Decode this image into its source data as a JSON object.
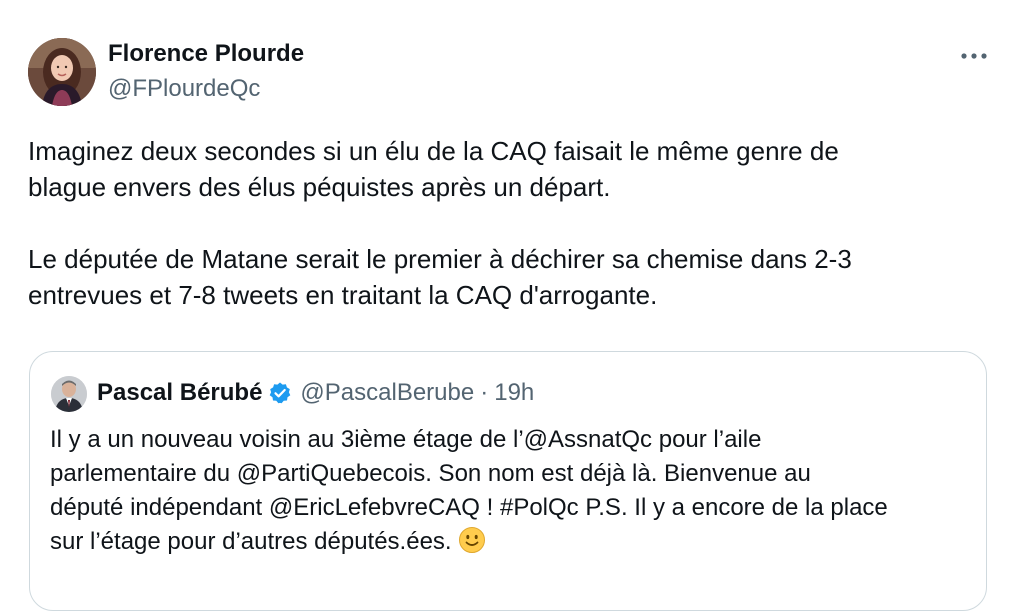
{
  "tweet": {
    "author": {
      "name": "Florence Plourde",
      "handle": "@FPlourdeQc"
    },
    "more_icon": "more-horizontal-icon",
    "text": {
      "paragraph_1_line_1": "Imaginez deux secondes si un élu de la CAQ faisait le même genre de",
      "paragraph_1_line_2": "blague envers des élus péquistes après un départ.",
      "paragraph_2_line_1": "Le députée de Matane serait le premier à déchirer sa chemise dans 2-3",
      "paragraph_2_line_2": "entrevues et 7-8 tweets en traitant la CAQ d'arrogante."
    }
  },
  "quoted_tweet": {
    "author": {
      "name": "Pascal Bérubé",
      "handle": "@PascalBerube",
      "separator": "·",
      "time": "19h",
      "verified_icon": "verified-badge-icon"
    },
    "text": {
      "line_1": "Il y a un nouveau voisin au 3ième étage de l’@AssnatQc pour l’aile",
      "line_2": "parlementaire du @PartiQuebecois. Son nom est déjà là. Bienvenue au",
      "line_3": "député indépendant @EricLefebvreCAQ ! #PolQc P.S. Il y a encore de la place",
      "line_4": "sur l’étage pour d’autres députés.ées.",
      "emoji": "slightly-smiling-face-icon"
    }
  },
  "colors": {
    "text_primary": "#0f1419",
    "text_secondary": "#536471",
    "border": "#cfd9de",
    "verified_blue": "#1d9bf0"
  }
}
